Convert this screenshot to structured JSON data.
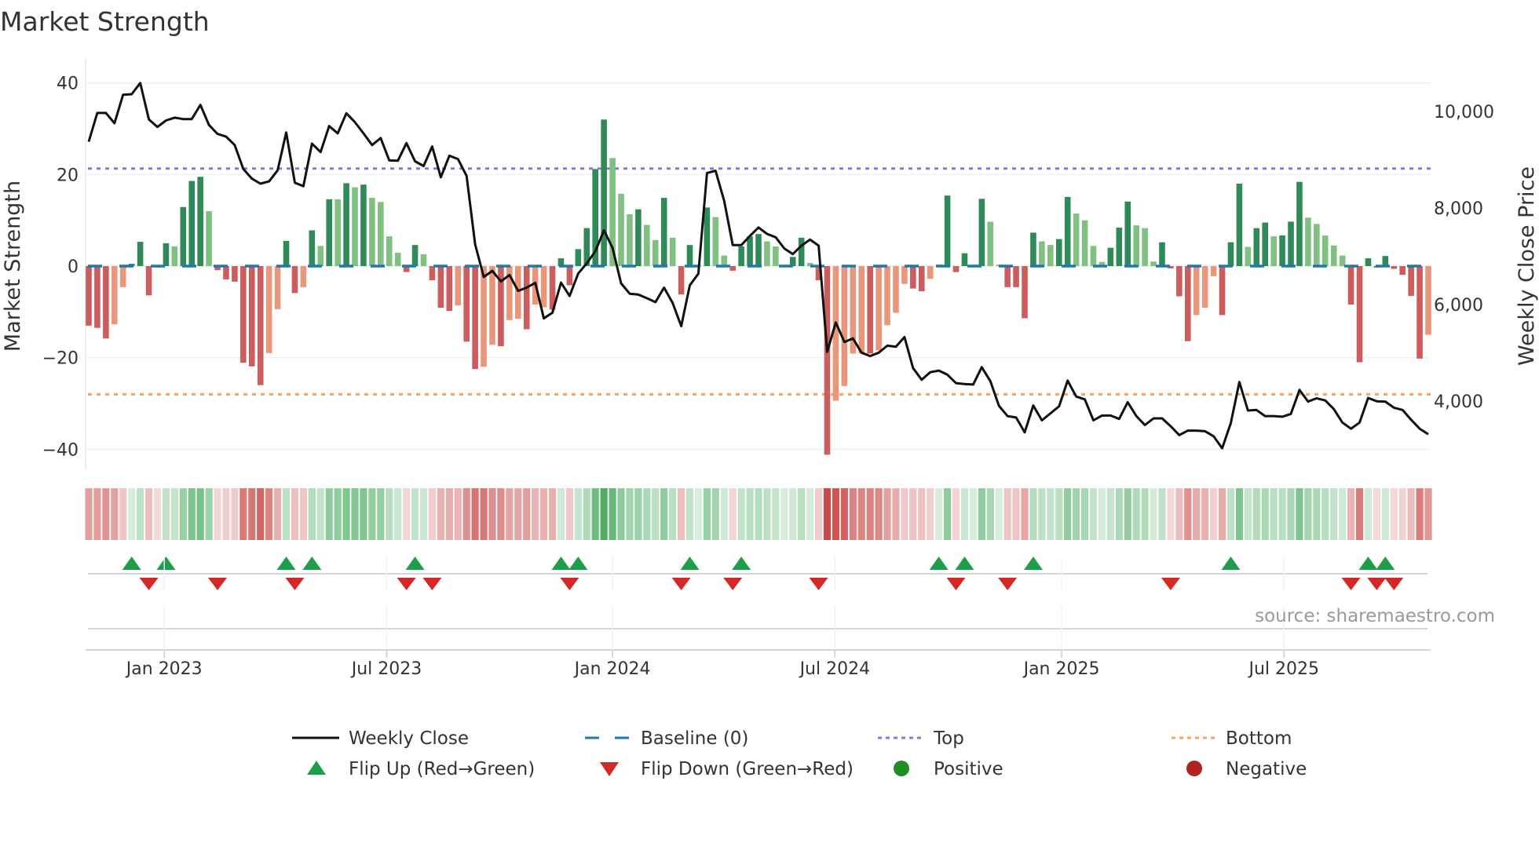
{
  "chart_data": {
    "type": "bar",
    "title": "Market Strength",
    "ylabel": "Market Strength",
    "y2label": "Weekly Close Price",
    "ylim": [
      -44.4,
      44.4
    ],
    "y2lim": [
      2585,
      11010
    ],
    "yticks": [
      40,
      20,
      0,
      -20,
      -40
    ],
    "ytick_labels": [
      "40",
      "20",
      "0",
      "−20",
      "−40"
    ],
    "y2ticks": [
      10000,
      8000,
      6000,
      4000
    ],
    "y2tick_labels": [
      "10,000",
      "8,000",
      "6,000",
      "4,000"
    ],
    "xticks": [
      {
        "week": 8.8,
        "label": "Jan 2023"
      },
      {
        "week": 34.7,
        "label": "Jul 2023"
      },
      {
        "week": 61.0,
        "label": "Jan 2024"
      },
      {
        "week": 86.9,
        "label": "Jul 2024"
      },
      {
        "week": 113.3,
        "label": "Jan 2025"
      },
      {
        "week": 139.2,
        "label": "Jul 2025"
      }
    ],
    "grid": true,
    "legend_position": "bottom",
    "reference_lines": {
      "top": 21.3,
      "bottom": -28,
      "baseline": 0
    },
    "strength_values": [
      -13,
      -13.5,
      -15.8,
      -12.7,
      -4.6,
      0.5,
      5.3,
      -6.4,
      -0.3,
      5.0,
      4.3,
      12.9,
      18.6,
      19.5,
      12.0,
      -0.9,
      -2.9,
      -3.4,
      -21.1,
      -21.9,
      -26,
      -19,
      -9.4,
      5.5,
      -5.9,
      -4.6,
      7.8,
      4.4,
      14.6,
      14.6,
      18.1,
      17.2,
      17.8,
      14.9,
      14.0,
      6.5,
      2.9,
      -1.3,
      4.6,
      2.6,
      -3.1,
      -9.1,
      -9.8,
      -8.6,
      -16.5,
      -22.5,
      -22,
      -17.2,
      -17.5,
      -11.8,
      -11.5,
      -13.8,
      -8.4,
      -9,
      -9.5,
      1.7,
      -4.2,
      3.7,
      8.3,
      21.2,
      32,
      23.6,
      15.8,
      11.3,
      12.4,
      9,
      5.7,
      14.9,
      6.2,
      -6.2,
      4.6,
      0.2,
      12.8,
      10.7,
      2.3,
      -1,
      4.3,
      6.5,
      7.0,
      5.4,
      4.3,
      0.3,
      2.0,
      6.2,
      0.7,
      -3.1,
      -41.2,
      -29.4,
      -26.2,
      -19.1,
      -19.1,
      -19.1,
      -18.4,
      -12.9,
      -10.2,
      -3.9,
      -4.9,
      -5.5,
      -2.8,
      0.3,
      15.4,
      -1.3,
      2.8,
      0.3,
      14.7,
      9.7,
      0.3,
      -4.6,
      -4.6,
      -11.4,
      7.3,
      5.4,
      4.6,
      5.9,
      15.1,
      11.5,
      10,
      4.4,
      0.9,
      4,
      8.4,
      14.1,
      8.9,
      8.3,
      1.0,
      5.2,
      -0.5,
      -6.6,
      -16.4,
      -10.7,
      -9.1,
      -2.2,
      -10.7,
      5.2,
      18,
      4.2,
      8.3,
      9.5,
      6.5,
      6.7,
      9.7,
      18.4,
      10.6,
      9.2,
      6.7,
      4.5,
      2.3,
      -8.4,
      -21,
      1.7,
      -0.3,
      2.2,
      -0.6,
      -1.9,
      -6.5,
      -20.2,
      -15
    ],
    "strength_shades": "RRRrrGGRRGgGGGgRRRRRRrrGRrGgGgGgGggggRGgRRRrRRrrRrrRrrRGRGGGGgggGggGgRGgGggRGGGgggGGgRRrrrrRrrrrRRrRGRGgGggRRRGggGGggggGGGgggGRRRrrrRGGgGGgGGGgggggRRGGGRRRRr",
    "weekly_close": [
      9375,
      9971,
      9971,
      9757,
      10347,
      10359,
      10590,
      9838,
      9682,
      9815,
      9873,
      9844,
      9844,
      10139,
      9722,
      9537,
      9479,
      9305,
      8813,
      8610,
      8506,
      8552,
      8784,
      9566,
      8524,
      8454,
      9334,
      9160,
      9699,
      9548,
      9965,
      9780,
      9548,
      9305,
      9450,
      8987,
      8981,
      9346,
      8969,
      8871,
      9276,
      8639,
      9085,
      9016,
      8668,
      7250,
      6572,
      6700,
      6480,
      6613,
      6283,
      6352,
      6451,
      5715,
      5831,
      6456,
      6178,
      6642,
      6856,
      7105,
      7539,
      7174,
      6439,
      6225,
      6207,
      6132,
      6051,
      6352,
      6034,
      5553,
      6399,
      6642,
      8726,
      8773,
      8147,
      7232,
      7232,
      7423,
      7597,
      7464,
      7394,
      7163,
      7047,
      7221,
      7348,
      7221,
      5021,
      5629,
      5224,
      5299,
      5003,
      4934,
      5003,
      5148,
      5125,
      5327,
      4685,
      4442,
      4598,
      4633,
      4546,
      4372,
      4355,
      4343,
      4702,
      4413,
      3903,
      3689,
      3660,
      3353,
      3909,
      3602,
      3747,
      3892,
      4424,
      4094,
      4036,
      3602,
      3701,
      3701,
      3631,
      3978,
      3689,
      3504,
      3643,
      3643,
      3480,
      3295,
      3388,
      3388,
      3376,
      3272,
      3023,
      3544,
      4395,
      3805,
      3816,
      3689,
      3689,
      3677,
      3735,
      4233,
      3990,
      4059,
      4013,
      3834,
      3556,
      3428,
      3556,
      4065,
      3996,
      3990,
      3863,
      3816,
      3614,
      3428,
      3313
    ],
    "flip_up_weeks": [
      5,
      9,
      23,
      26,
      38,
      55,
      57,
      70,
      76,
      99,
      102,
      110,
      133,
      149,
      151
    ],
    "flip_down_weeks": [
      7,
      15,
      24,
      37,
      40,
      56,
      69,
      75,
      85,
      101,
      107,
      126,
      147,
      150,
      152
    ]
  },
  "legend": {
    "weekly_close": "Weekly Close",
    "baseline": "Baseline (0)",
    "top": "Top",
    "bottom": "Bottom",
    "flip_up": "Flip Up (Red→Green)",
    "flip_down": "Flip Down (Green→Red)",
    "positive": "Positive",
    "negative": "Negative"
  },
  "source": "source: sharemaestro.com",
  "colors": {
    "dark_green": "#2e8b57",
    "light_green": "#80c080",
    "dark_red": "#cd5c5c",
    "light_red": "#e9967a",
    "close_line": "#111111",
    "baseline": "#1f77b4",
    "top": "#9370db",
    "bottom": "#f4a460",
    "flip_up": "#1e9e48",
    "flip_down": "#d62728",
    "positive": "#228b22",
    "negative": "#b22222"
  }
}
